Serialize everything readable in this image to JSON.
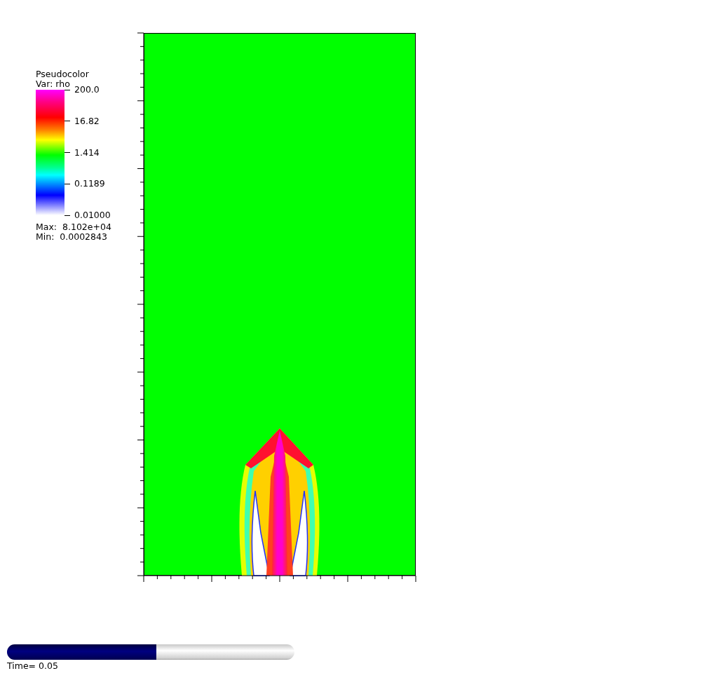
{
  "legend": {
    "title": "Pseudocolor",
    "variable": "Var: rho",
    "tick_labels": [
      "200.0",
      "16.82",
      "1.414",
      "0.1189",
      "0.01000"
    ],
    "max": "Max:  8.102e+04",
    "min": "Min:  0.0002843"
  },
  "time_slider": {
    "level": 0.52,
    "label": "Time= 0.05"
  }
}
